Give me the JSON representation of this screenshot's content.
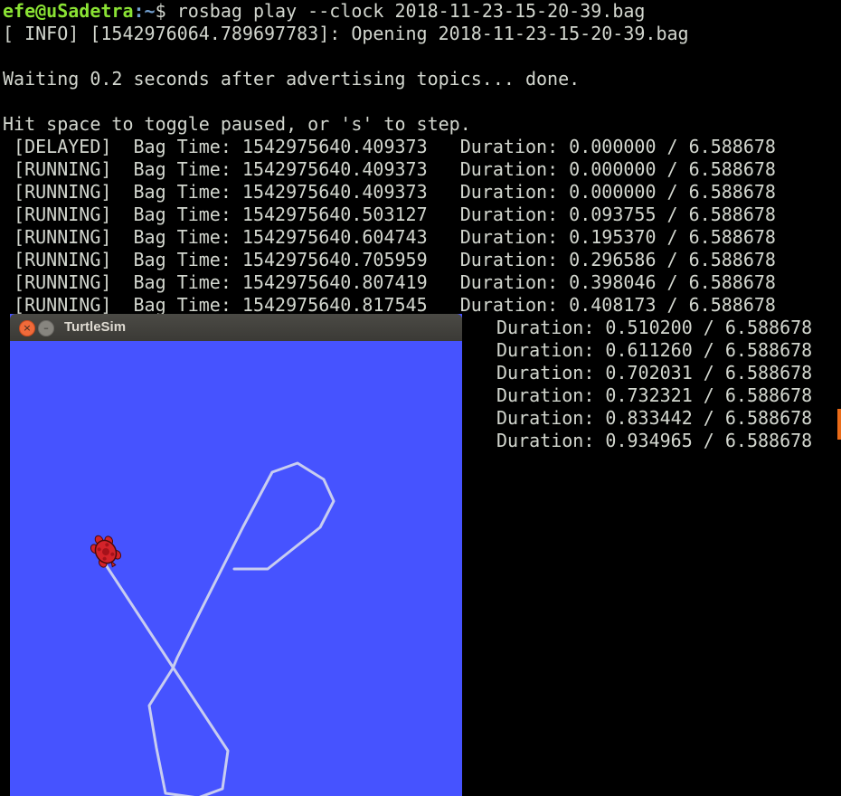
{
  "terminal": {
    "prompt_user": "efe@uSadetra",
    "prompt_path": ":~",
    "prompt_symbol": "$ ",
    "command": "rosbag play --clock 2018-11-23-15-20-39.bag",
    "info_line": "[ INFO] [1542976064.789697783]: Opening 2018-11-23-15-20-39.bag",
    "waiting_line": "Waiting 0.2 seconds after advertising topics... done.",
    "hint_line": "Hit space to toggle paused, or 's' to step.",
    "status_rows": [
      {
        "state": "[DELAYED]",
        "bag_time": "1542975640.409373",
        "duration": "0.000000 / 6.588678"
      },
      {
        "state": "[RUNNING]",
        "bag_time": "1542975640.409373",
        "duration": "0.000000 / 6.588678"
      },
      {
        "state": "[RUNNING]",
        "bag_time": "1542975640.409373",
        "duration": "0.000000 / 6.588678"
      },
      {
        "state": "[RUNNING]",
        "bag_time": "1542975640.503127",
        "duration": "0.093755 / 6.588678"
      },
      {
        "state": "[RUNNING]",
        "bag_time": "1542975640.604743",
        "duration": "0.195370 / 6.588678"
      },
      {
        "state": "[RUNNING]",
        "bag_time": "1542975640.705959",
        "duration": "0.296586 / 6.588678"
      },
      {
        "state": "[RUNNING]",
        "bag_time": "1542975640.807419",
        "duration": "0.398046 / 6.588678"
      },
      {
        "state": "[RUNNING]",
        "bag_time": "1542975640.817545",
        "duration": "0.408173 / 6.588678"
      }
    ],
    "duration_rows": [
      "0.510200 / 6.588678",
      "0.611260 / 6.588678",
      "0.702031 / 6.588678",
      "0.732321 / 6.588678",
      "0.833442 / 6.588678",
      "0.934965 / 6.588678"
    ]
  },
  "turtlesim": {
    "title": "TurtleSim",
    "close_icon": "×",
    "minimize_icon": "–",
    "background_color": "#4653ff",
    "path_color": "#c8cdf0",
    "turtle_color": "#d4232a"
  }
}
